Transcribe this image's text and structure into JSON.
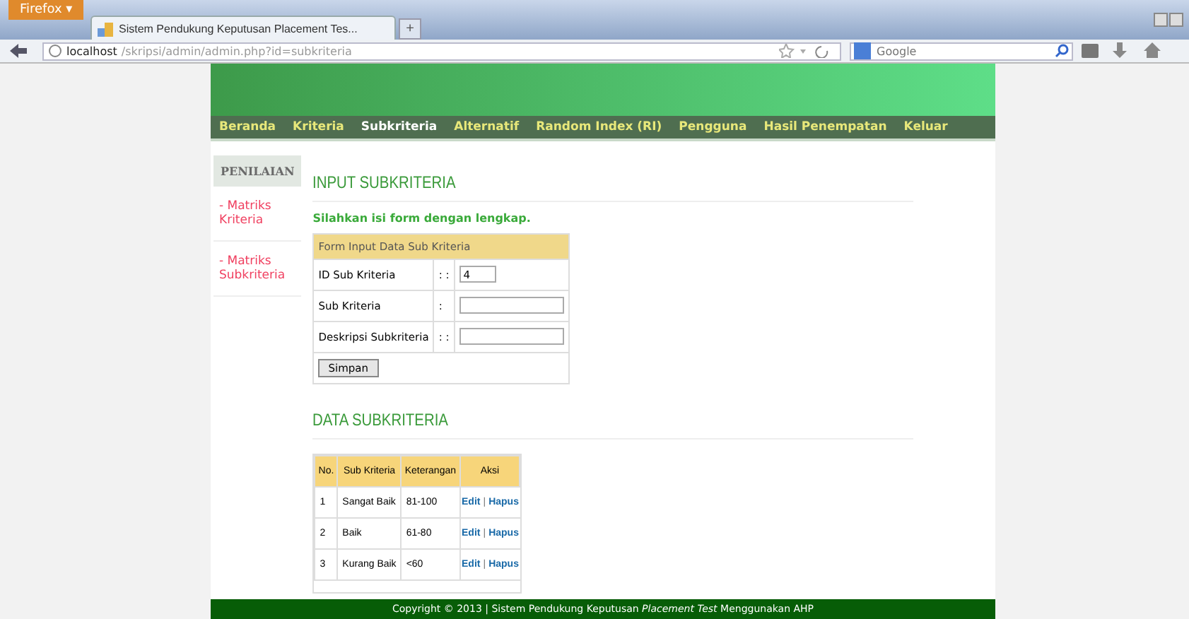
{
  "browser": {
    "menu_button": "Firefox",
    "menu_caret": "▾",
    "tab_title": "Sistem Pendukung Keputusan Placement Tes...",
    "new_tab": "+",
    "url_host": "localhost",
    "url_path": "/skripsi/admin/admin.php?id=subkriteria",
    "search": {
      "placeholder": "Google"
    }
  },
  "nav": [
    {
      "label": "Beranda",
      "selected": false
    },
    {
      "label": "Kriteria",
      "selected": false
    },
    {
      "label": "Subkriteria",
      "selected": true
    },
    {
      "label": "Alternatif",
      "selected": false
    },
    {
      "label": "Random Index (RI)",
      "selected": false
    },
    {
      "label": "Pengguna",
      "selected": false
    },
    {
      "label": "Hasil Penempatan",
      "selected": false
    },
    {
      "label": "Keluar",
      "selected": false
    }
  ],
  "sidebar": {
    "title": "PENILAIAN",
    "items": [
      "- Matriks Kriteria",
      "- Matriks Subkriteria"
    ]
  },
  "input_section": {
    "heading": "INPUT SUBKRITERIA",
    "note": "Silahkan isi form dengan lengkap.",
    "form_title": "Form Input Data Sub Kriteria",
    "fields": [
      {
        "label": "ID Sub Kriteria",
        "colon": ": :",
        "value": "4",
        "kind": "short"
      },
      {
        "label": "Sub Kriteria",
        "colon": ":",
        "kind": "long"
      },
      {
        "label": "Deskripsi Subkriteria",
        "colon": ": :",
        "kind": "long"
      }
    ],
    "submit": "Simpan"
  },
  "data_section": {
    "heading": "DATA SUBKRITERIA",
    "columns": [
      "No.",
      "Sub Kriteria",
      "Keterangan",
      "Aksi"
    ],
    "rows": [
      {
        "no": "1",
        "name": "Sangat Baik",
        "note": "81-100",
        "edit": "Edit",
        "sep": "|",
        "delete": "Hapus"
      },
      {
        "no": "2",
        "name": "Baik",
        "note": "61-80",
        "edit": "Edit",
        "sep": "|",
        "delete": "Hapus"
      },
      {
        "no": "3",
        "name": "Kurang Baik",
        "note": "<60",
        "edit": "Edit",
        "sep": "|",
        "delete": "Hapus"
      }
    ]
  },
  "footer": "Copyright © 2013 | Sistem Pendukung Keputusan *Placement Test* Menggunakan AHP"
}
